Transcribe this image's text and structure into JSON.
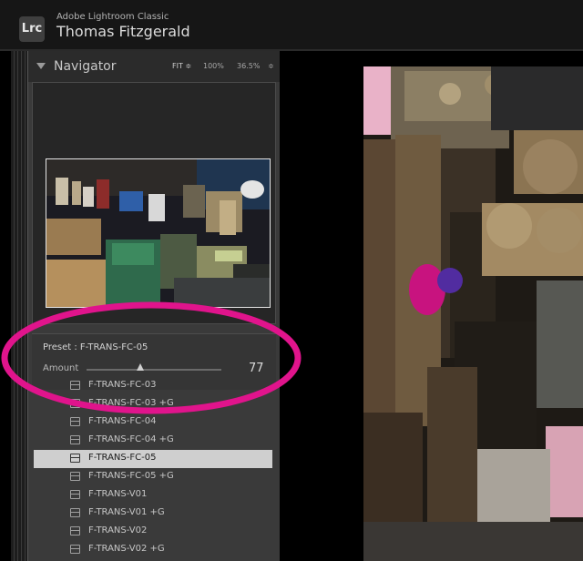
{
  "app": {
    "logo": "Lrc",
    "name": "Adobe Lightroom Classic",
    "catalog": "Thomas Fitzgerald"
  },
  "navigator": {
    "title": "Navigator",
    "zoom": {
      "fit": "FIT ≑",
      "z100": "100%",
      "z365": "36.5%",
      "arrow": "≑"
    }
  },
  "preset_amount": {
    "preset_label": "Preset : F-TRANS-FC-05",
    "amount_label": "Amount",
    "amount_value": "77",
    "amount_fraction": 0.4
  },
  "presets": [
    {
      "label": "F-TRANS-FC-03",
      "selected": false
    },
    {
      "label": "F-TRANS-FC-03 +G",
      "selected": false
    },
    {
      "label": "F-TRANS-FC-04",
      "selected": false
    },
    {
      "label": "F-TRANS-FC-04 +G",
      "selected": false
    },
    {
      "label": "F-TRANS-FC-05",
      "selected": true
    },
    {
      "label": "F-TRANS-FC-05 +G",
      "selected": false
    },
    {
      "label": "F-TRANS-V01",
      "selected": false
    },
    {
      "label": "F-TRANS-V01 +G",
      "selected": false
    },
    {
      "label": "F-TRANS-V02",
      "selected": false
    },
    {
      "label": "F-TRANS-V02 +G",
      "selected": false
    }
  ],
  "colors": {
    "annotation": "#e0148c",
    "selected_row": "#cfcfcf",
    "panel": "#3a3a3a"
  },
  "icons": {
    "collapse": "triangle-down-icon",
    "preset": "preset-list-icon"
  }
}
